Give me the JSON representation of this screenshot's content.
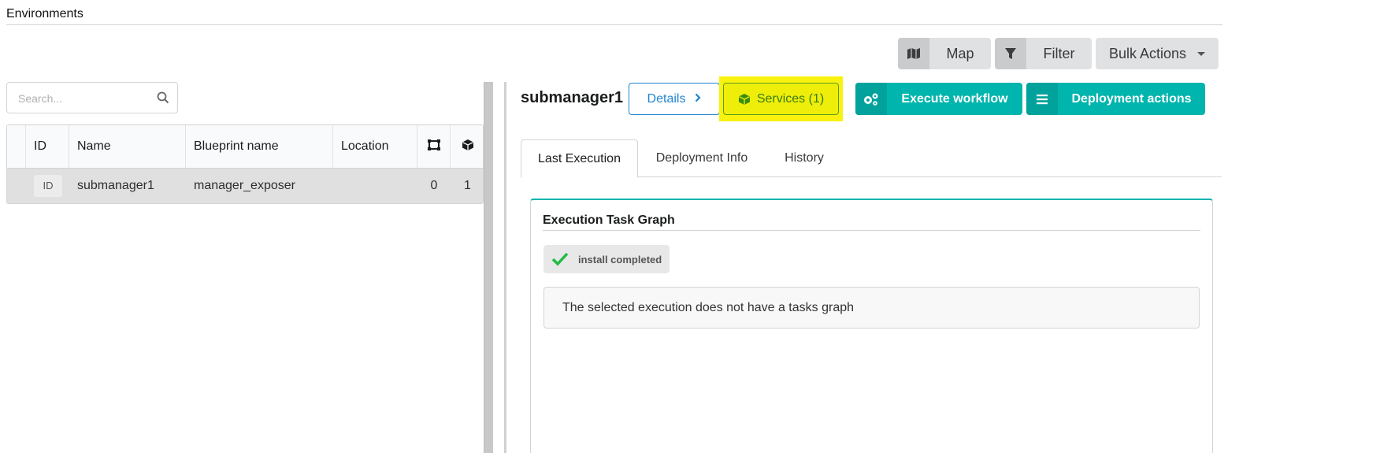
{
  "header": {
    "title": "Environments"
  },
  "toolbar": {
    "map_label": "Map",
    "filter_label": "Filter",
    "bulk_label": "Bulk Actions"
  },
  "search": {
    "placeholder": "Search..."
  },
  "table": {
    "columns": [
      "ID",
      "Name",
      "Blueprint name",
      "Location",
      "nodes-icon",
      "services-icon"
    ],
    "rows": [
      {
        "id": "ID",
        "name": "submanager1",
        "blueprint": "manager_exposer",
        "location": "",
        "nodes": "0",
        "services": "1"
      }
    ]
  },
  "deployment": {
    "title": "submanager1",
    "details_label": "Details",
    "services_label": "Services (1)",
    "execute_label": "Execute workflow",
    "actions_label": "Deployment actions"
  },
  "tabs": [
    "Last Execution",
    "Deployment Info",
    "History"
  ],
  "execution": {
    "section_title": "Execution Task Graph",
    "status_label": "install completed",
    "message": "The selected execution does not have a tasks graph"
  },
  "colors": {
    "teal": "#00b5ad",
    "primary_blue": "#2185d0",
    "highlight_yellow": "#f9f20e",
    "success_green": "#21ba45"
  }
}
